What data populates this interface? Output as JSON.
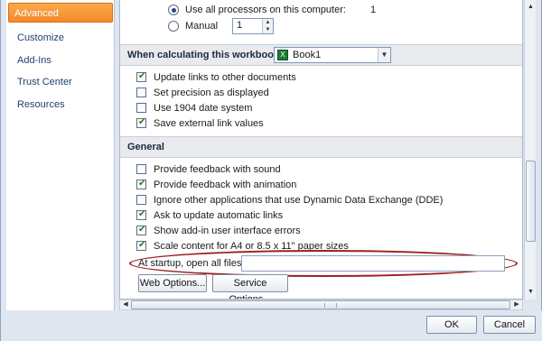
{
  "sidebar": {
    "items": [
      {
        "label": "Advanced"
      },
      {
        "label": "Customize"
      },
      {
        "label": "Add-Ins"
      },
      {
        "label": "Trust Center"
      },
      {
        "label": "Resources"
      }
    ]
  },
  "processors": {
    "use_all_label": "Use all processors on this computer:",
    "use_all_count": "1",
    "manual_label": "Manual",
    "manual_value": "1"
  },
  "workbook": {
    "header": "When calculating this workbook:",
    "selected": "Book1",
    "options": [
      {
        "label": "Update links to other documents",
        "checked": true
      },
      {
        "label": "Set precision as displayed",
        "checked": false
      },
      {
        "label": "Use 1904 date system",
        "checked": false
      },
      {
        "label": "Save external link values",
        "checked": true
      }
    ]
  },
  "general": {
    "header": "General",
    "options": [
      {
        "label": "Provide feedback with sound",
        "checked": false
      },
      {
        "label": "Provide feedback with animation",
        "checked": true
      },
      {
        "label": "Ignore other applications that use Dynamic Data Exchange (DDE)",
        "checked": false
      },
      {
        "label": "Ask to update automatic links",
        "checked": true
      },
      {
        "label": "Show add-in user interface errors",
        "checked": true
      },
      {
        "label": "Scale content for A4 or 8.5 x 11\" paper sizes",
        "checked": true
      }
    ],
    "startup_label": "At startup, open all files in:",
    "startup_value": "",
    "web_options": "Web Options...",
    "service_options": "Service Options..."
  },
  "footer": {
    "ok": "OK",
    "cancel": "Cancel"
  },
  "colors": {
    "accent": "#f4892a",
    "highlight_ellipse": "#9b1e1e"
  }
}
